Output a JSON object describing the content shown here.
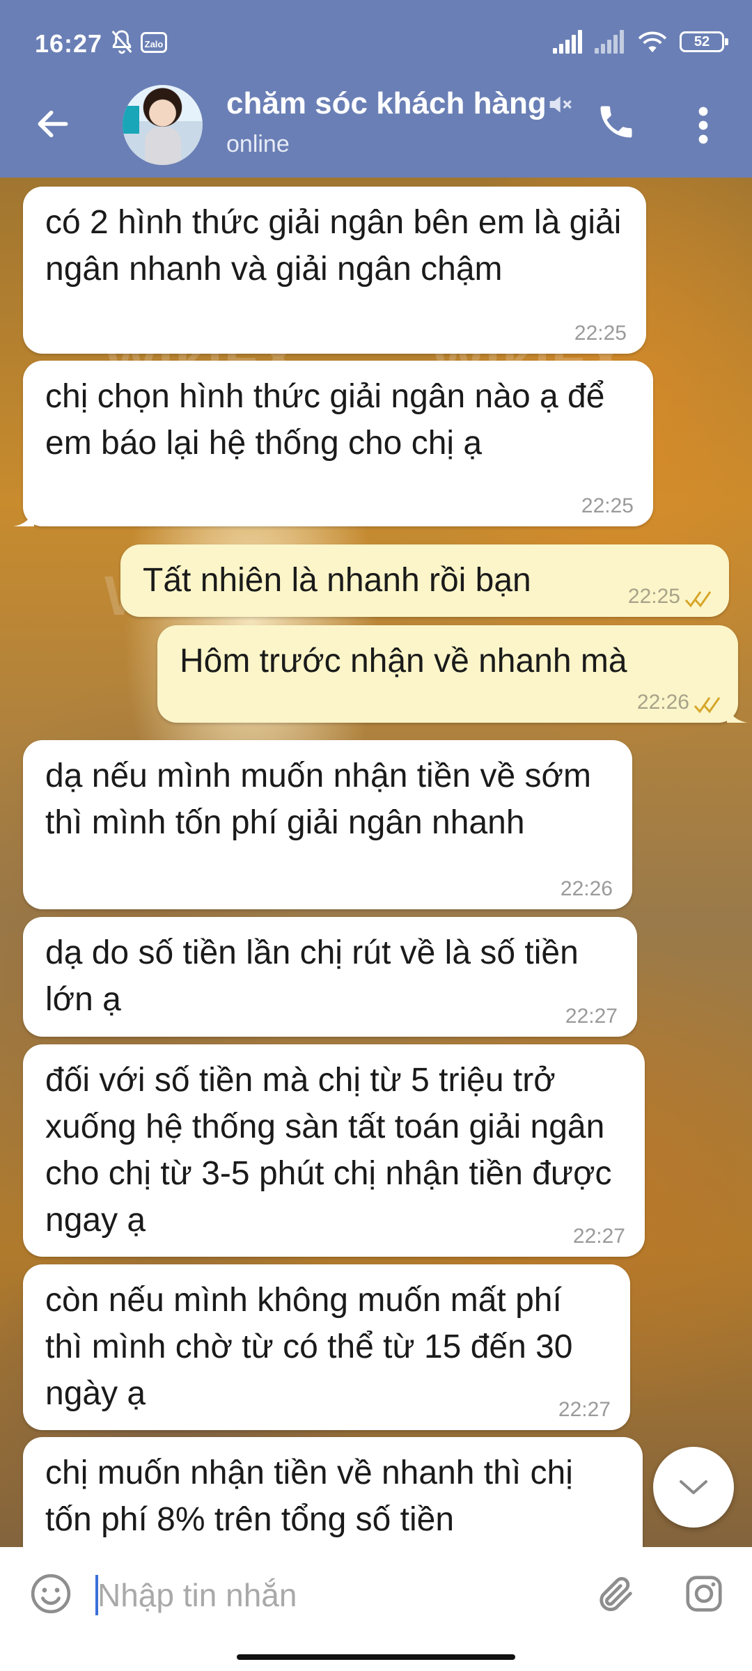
{
  "status_bar": {
    "time": "16:27",
    "battery": "52"
  },
  "header": {
    "title": "chăm sóc khách hàng",
    "subtitle": "online"
  },
  "messages": [
    {
      "direction": "in",
      "text": "có 2 hình thức giải ngân bên em là giải ngân nhanh và giải ngân chậm",
      "time": "22:25"
    },
    {
      "direction": "in",
      "text": "chị chọn hình thức giải ngân nào ạ để em báo lại hệ thống cho chị ạ",
      "time": "22:25"
    },
    {
      "direction": "out",
      "text": "Tất nhiên là nhanh rồi bạn",
      "time": "22:25",
      "status": "read"
    },
    {
      "direction": "out",
      "text": "Hôm trước nhận về nhanh mà",
      "time": "22:26",
      "status": "read"
    },
    {
      "direction": "in",
      "text": "dạ nếu mình muốn nhận tiền về sớm thì mình tốn phí giải ngân nhanh",
      "time": "22:26"
    },
    {
      "direction": "in",
      "text": "dạ do số tiền lần chị rút về là số tiền lớn ạ",
      "time": "22:27"
    },
    {
      "direction": "in",
      "text": "đối với số tiền mà chị từ 5 triệu trở xuống hệ thống sàn tất toán giải ngân cho chị từ 3-5 phút chị nhận tiền được ngay ạ",
      "time": "22:27"
    },
    {
      "direction": "in",
      "text": "còn nếu mình không muốn mất phí thì mình chờ từ có thể từ 15 đến 30 ngày ạ",
      "time": "22:27"
    },
    {
      "direction": "in",
      "text": "chị muốn nhận tiền về nhanh thì chị tốn phí 8% trên tổng số tiền",
      "time": ""
    }
  ],
  "composer": {
    "placeholder": "Nhập tin nhắn"
  },
  "watermark": "WikiFX",
  "colors": {
    "header": "#6a7fb5",
    "incoming_bubble": "#ffffff",
    "outgoing_bubble": "#fbf5c9",
    "read_ticks": "#d7a629"
  }
}
